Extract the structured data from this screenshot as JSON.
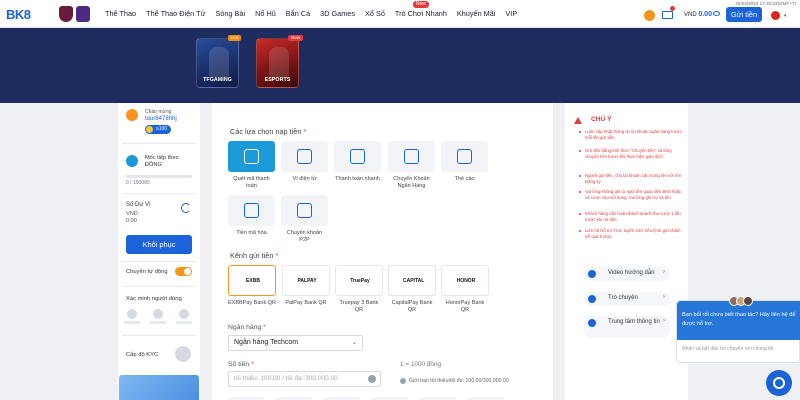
{
  "header": {
    "logo_text": "BK8",
    "nav": [
      {
        "label": "Thể Thao",
        "new": false
      },
      {
        "label": "Thể Thao Điện Tử",
        "new": false
      },
      {
        "label": "Sòng Bài",
        "new": false
      },
      {
        "label": "Nổ Hũ",
        "new": false
      },
      {
        "label": "Bắn Cá",
        "new": false
      },
      {
        "label": "3D Games",
        "new": false
      },
      {
        "label": "Xổ Số",
        "new": false
      },
      {
        "label": "Trò Chơi Nhanh",
        "new": true
      },
      {
        "label": "Khuyến Mãi",
        "new": false
      },
      {
        "label": "VIP",
        "new": false
      }
    ],
    "new_tag": "New",
    "datetime": "20/03/2024 17:20:22(GMT+7)",
    "currency": "VND",
    "balance": "0.00",
    "deposit_button": "Gửi tiền",
    "notif_count": "1"
  },
  "banner": {
    "games": [
      {
        "name": "TFGAMING",
        "tag": "Hot"
      },
      {
        "name": "ESPORTS",
        "tag": "New"
      }
    ]
  },
  "sidebar": {
    "welcome": "Chào mừng",
    "username": "tour8478hhj",
    "vip_badge": "≥100",
    "level_title": "Mốc tiếp theo ĐỒNG",
    "level_progress": "0 / 150000",
    "level_fraction": 0,
    "balance_title": "Số Dư Ví",
    "balance_currency": "VND",
    "balance_value": "0.00",
    "restore_button": "Khôi phục",
    "auto_transfer_label": "Chuyển tự động",
    "auto_transfer_on": true,
    "verify_title": "Xác minh người dùng",
    "kyc_title": "Cấp độ KYC"
  },
  "main": {
    "options_title": "Các lựa chọn nạp tiền",
    "options": [
      {
        "label": "Quét mã thanh toán",
        "selected": true,
        "icon": "qr-scan-icon"
      },
      {
        "label": "Ví điện tử",
        "selected": false,
        "icon": "qr-code-icon"
      },
      {
        "label": "Thanh toán nhanh",
        "selected": false,
        "icon": "fast-pay-icon"
      },
      {
        "label": "Chuyển Khoản Ngân Hàng",
        "selected": false,
        "icon": "bank-icon"
      },
      {
        "label": "Thẻ cào",
        "selected": false,
        "icon": "card-icon"
      },
      {
        "label": "Tiền mã hóa",
        "selected": false,
        "icon": "crypto-icon"
      },
      {
        "label": "Chuyển khoản P2P",
        "selected": false,
        "icon": "p2p-icon"
      }
    ],
    "channel_title": "Kênh gửi tiền",
    "channels": [
      {
        "label": "EXBBPay Bank QR",
        "mark": "EXBB",
        "selected": true
      },
      {
        "label": "PalPay Bank QR",
        "mark": "PALPAY",
        "selected": false
      },
      {
        "label": "Truepay 3 Bank QR",
        "mark": "TruePay",
        "selected": false
      },
      {
        "label": "CapitalPay Bank QR",
        "mark": "CAPITAL",
        "selected": false
      },
      {
        "label": "HonorPay Bank QR",
        "mark": "HONOR",
        "selected": false
      }
    ],
    "bank_label": "Ngân hàng",
    "bank_value": "Ngân hàng Techcom",
    "amount_label": "Số tiền",
    "amount_placeholder": "tối thiểu: 100,00 / tối đa: 300,000.00",
    "rate_text": "1 = 1000 đồng",
    "limit_text": "Giới hạn tối thiểu/tối đa: 100.00/300,000.00"
  },
  "notes": {
    "title": "CHÚ Ý",
    "items": [
      "Luôn cập nhật thông tin tài khoản ngân hàng trước mỗi lần gửi tiền.",
      "Gửi tiền bằng tính thức \"Chuyển tiền\" và tông chuyển tiền trước khi thực hiện giao dịch.",
      "Người gửi tiền, chủ tài khoản cần trùng tên với tên Đăng ký.",
      "Vui lòng không ghi từ ngữ liên quan đến BK8 hoặc cá cược vào nội dung. Vui lòng ghi Họ và tên.",
      "Khách hàng cần hoàn thành doanh thu cược 1 lần trước khi rút tiền.",
      "Liên hệ Hỗ trợ Trực tuyến 24/7 nếu lệnh gửi chậm trễ quá 5 phút."
    ],
    "help": [
      {
        "label": "Video hướng dẫn",
        "icon": "video-icon"
      },
      {
        "label": "Trò chuyện",
        "icon": "chat-icon"
      },
      {
        "label": "Trung tâm thông tin",
        "icon": "info-center-icon"
      }
    ]
  },
  "chat": {
    "message": "Bạn bối rối chưa biết thao tác? Hãy liên hệ để được hỗ trợ.",
    "input_placeholder": "Nhấn và bắt đầu trò chuyện với chúng tôi"
  },
  "colors": {
    "accent": "#1a63d8",
    "banner": "#1e2c60",
    "warning": "#e23b3b",
    "selected_border": "#f7941d"
  }
}
